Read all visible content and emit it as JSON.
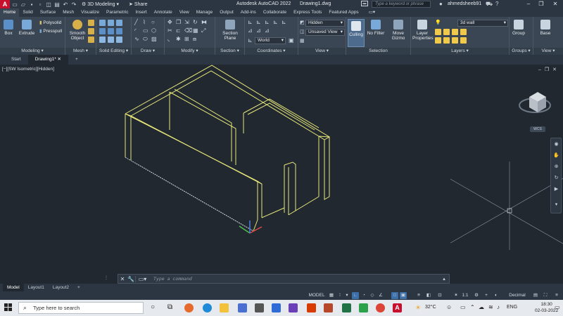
{
  "titlebar": {
    "app_logo": "A",
    "workspace": "3D Modeling",
    "share": "Share",
    "app_title": "Autodesk AutoCAD 2022",
    "document": "Drawing1.dwg",
    "search_placeholder": "Type a keyword or phrase",
    "user": "ahmedsheeb91"
  },
  "ribbon_tabs": [
    "Home",
    "Solid",
    "Surface",
    "Mesh",
    "Visualize",
    "Parametric",
    "Insert",
    "Annotate",
    "View",
    "Manage",
    "Output",
    "Add-ins",
    "Collaborate",
    "Express Tools",
    "Featured Apps"
  ],
  "ribbon": {
    "modeling": {
      "title": "Modeling",
      "box": "Box",
      "extrude": "Extrude",
      "polysolid": "Polysolid",
      "presspull": "Presspull"
    },
    "mesh": {
      "title": "Mesh",
      "smooth_object_1": "Smooth",
      "smooth_object_2": "Object"
    },
    "solid_editing": {
      "title": "Solid Editing"
    },
    "draw": {
      "title": "Draw"
    },
    "modify": {
      "title": "Modify"
    },
    "section": {
      "title": "Section",
      "section_plane_1": "Section",
      "section_plane_2": "Plane"
    },
    "coordinates": {
      "title": "Coordinates",
      "ucs_value": "World"
    },
    "view": {
      "title": "View",
      "visual_style": "Hidden",
      "saved_view": "Unsaved View"
    },
    "selection": {
      "title": "Selection",
      "culling": "Culling",
      "no_filter": "No Filter",
      "move_gizmo_1": "Move",
      "move_gizmo_2": "Gizmo"
    },
    "layers": {
      "title": "Layers",
      "layer_properties_1": "Layer",
      "layer_properties_2": "Properties",
      "current_layer": "3d wall"
    },
    "groups": {
      "title": "Groups",
      "group": "Group"
    },
    "view2": {
      "title": "View",
      "base": "Base"
    }
  },
  "file_tabs": [
    "Start",
    "Drawing1*"
  ],
  "viewport": {
    "label": "[−][SW Isometric][Hidden]",
    "wcs": "WCS"
  },
  "command_line": {
    "placeholder": "Type a command"
  },
  "layout_tabs": [
    "Model",
    "Layout1",
    "Layout2"
  ],
  "status_bar": {
    "model": "MODEL",
    "scale": "1:1",
    "units": "Decimal"
  },
  "taskbar": {
    "search_placeholder": "Type here to search",
    "weather": "32°C",
    "language": "ENG",
    "time": "18:30",
    "date": "02-03-2022"
  },
  "colors": {
    "model_lines": "#e8e87a",
    "ui_dark": "#212830",
    "ribbon": "#3a4654",
    "accent": "#3d6fa8",
    "autocad_red": "#c8102e"
  }
}
